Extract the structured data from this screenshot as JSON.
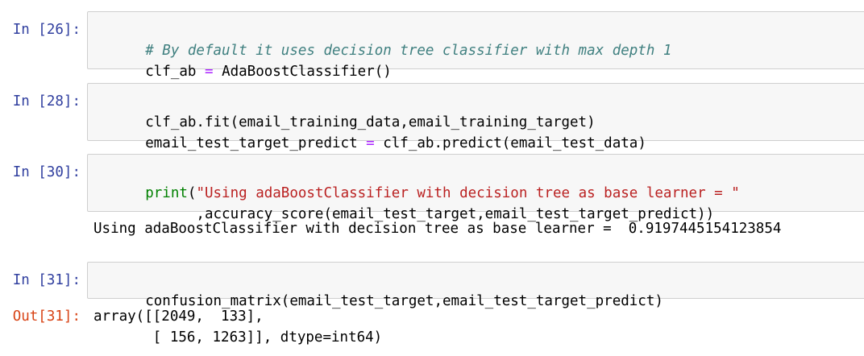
{
  "cells": [
    {
      "prompt": "In [26]:",
      "lines": [
        [
          {
            "t": "# By default it uses decision tree classifier with max depth 1",
            "c": "comment"
          }
        ],
        [
          {
            "t": "clf_ab ",
            "c": ""
          },
          {
            "t": "=",
            "c": "op"
          },
          {
            "t": " AdaBoostClassifier()",
            "c": ""
          }
        ]
      ]
    },
    {
      "prompt": "In [28]:",
      "lines": [
        [
          {
            "t": "clf_ab.fit(email_training_data,email_training_target)",
            "c": ""
          }
        ],
        [
          {
            "t": "email_test_target_predict ",
            "c": ""
          },
          {
            "t": "=",
            "c": "op"
          },
          {
            "t": " clf_ab.predict(email_test_data)",
            "c": ""
          }
        ]
      ]
    },
    {
      "prompt": "In [30]:",
      "lines": [
        [
          {
            "t": "print",
            "c": "builtin"
          },
          {
            "t": "(",
            "c": ""
          },
          {
            "t": "\"Using adaBoostClassifier with decision tree as base learner = \"",
            "c": "string"
          }
        ],
        [
          {
            "t": "      ,accuracy_score(email_test_target,email_test_target_predict))",
            "c": ""
          }
        ]
      ],
      "output": [
        "Using adaBoostClassifier with decision tree as base learner =  0.9197445154123854"
      ]
    },
    {
      "prompt": "In [31]:",
      "lines": [
        [
          {
            "t": "confusion_matrix(email_test_target,email_test_target_predict)",
            "c": ""
          }
        ]
      ],
      "out_prompt": "Out[31]:",
      "output": [
        "array([[2049,  133],",
        "       [ 156, 1263]], dtype=int64)"
      ]
    }
  ]
}
